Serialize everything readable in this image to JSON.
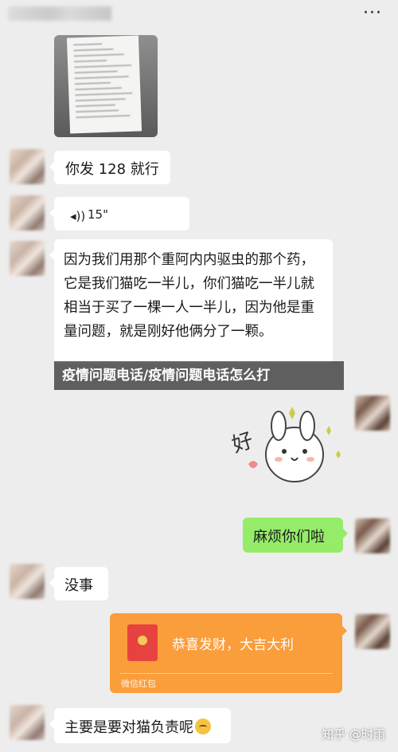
{
  "topbar": {
    "more_label": "···"
  },
  "messages": {
    "m1": "你发 128 就行",
    "voice": {
      "duration": "15\"",
      "icon": "voice-wave-icon"
    },
    "m3": "因为我们用那个重阿内内驱虫的那个药，它是我们猫吃一半儿，你们猫吃一半儿就相当于买了一棵一人一半儿，因为他是重量问题，就是刚好他俩分了一颗。",
    "m4": "麻烦你们啦",
    "m5": "没事",
    "red_packet": {
      "text": "恭喜发财，大吉大利",
      "label": "微信红包"
    },
    "m7": "主要是要对猫负责呢"
  },
  "banner": {
    "title": "疫情问题电话/疫情问题电话怎么打"
  },
  "sticker": {
    "text": "好"
  },
  "watermark": {
    "text": "知乎 @时雨"
  },
  "colors": {
    "background": "#ededed",
    "green_bubble": "#95ec69",
    "red_packet": "#fa9d3b"
  }
}
